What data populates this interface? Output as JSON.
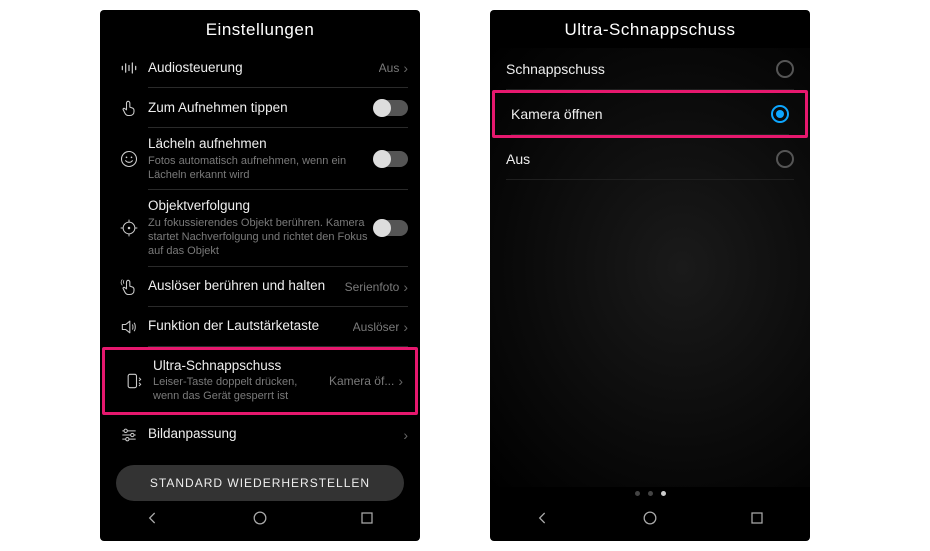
{
  "screen1": {
    "header": "Einstellungen",
    "items": [
      {
        "title": "Audiosteuerung",
        "value": "Aus"
      },
      {
        "title": "Zum Aufnehmen tippen"
      },
      {
        "title": "Lächeln aufnehmen",
        "sub": "Fotos automatisch aufnehmen, wenn ein Lächeln erkannt wird"
      },
      {
        "title": "Objektverfolgung",
        "sub": "Zu fokussierendes Objekt berühren. Kamera startet Nachverfolgung und richtet den Fokus auf das Objekt"
      },
      {
        "title": "Auslöser berühren und halten",
        "value": "Serienfoto"
      },
      {
        "title": "Funktion der Lautstärketaste",
        "value": "Auslöser"
      },
      {
        "title": "Ultra-Schnappschuss",
        "sub": "Leiser-Taste doppelt drücken, wenn das Gerät gesperrt ist",
        "value": "Kamera öf..."
      },
      {
        "title": "Bildanpassung"
      }
    ],
    "restore_button": "STANDARD WIEDERHERSTELLEN"
  },
  "screen2": {
    "header": "Ultra-Schnappschuss",
    "options": [
      {
        "label": "Schnappschuss"
      },
      {
        "label": "Kamera öffnen"
      },
      {
        "label": "Aus"
      }
    ]
  }
}
